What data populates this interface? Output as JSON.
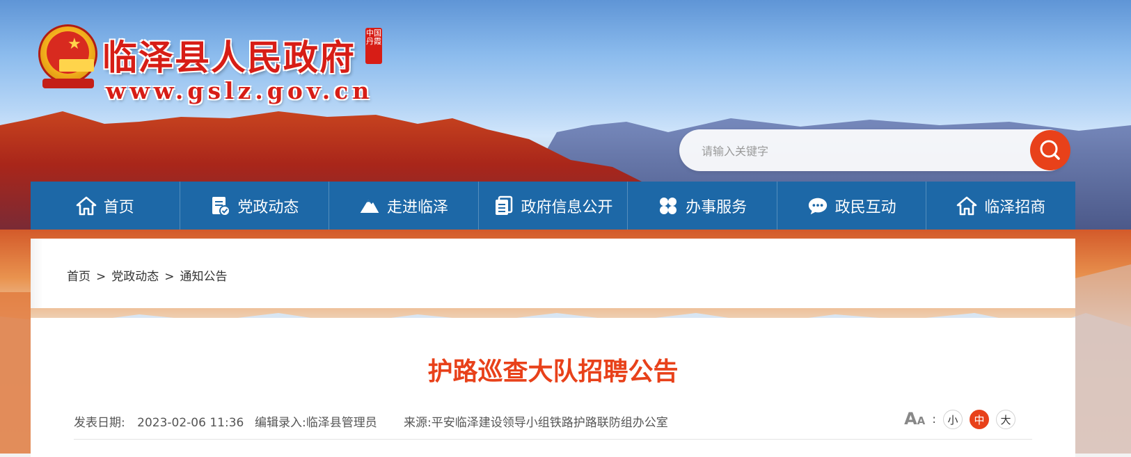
{
  "header": {
    "site_title": "临泽县人民政府",
    "seal_text": "中国丹霞",
    "site_url": "www.gslz.gov.cn"
  },
  "search": {
    "placeholder": "请输入关键字",
    "button_icon": "search-icon"
  },
  "nav": {
    "items": [
      {
        "label": "首页",
        "icon": "home-icon"
      },
      {
        "label": "党政动态",
        "icon": "document-check-icon"
      },
      {
        "label": "走进临泽",
        "icon": "mountain-icon"
      },
      {
        "label": "政府信息公开",
        "icon": "file-list-icon"
      },
      {
        "label": "办事服务",
        "icon": "grid-icon"
      },
      {
        "label": "政民互动",
        "icon": "chat-icon"
      },
      {
        "label": "临泽招商",
        "icon": "home-icon"
      }
    ]
  },
  "breadcrumb": {
    "items": [
      "首页",
      "党政动态",
      "通知公告"
    ],
    "separator": ">"
  },
  "article": {
    "title": "护路巡查大队招聘公告",
    "publish_label": "发表日期:",
    "publish_date": "2023-02-06 11:36",
    "editor_label": "编辑录入:",
    "editor": "临泽县管理员",
    "source_label": "来源:",
    "source": "平安临泽建设领导小组铁路护路联防组办公室",
    "font_size_label": ":",
    "font_sizes": [
      "小",
      "中",
      "大"
    ],
    "font_size_selected": "中"
  },
  "colors": {
    "nav_bg": "#1d68a7",
    "accent": "#e8411a",
    "title_red": "#d71d16"
  }
}
